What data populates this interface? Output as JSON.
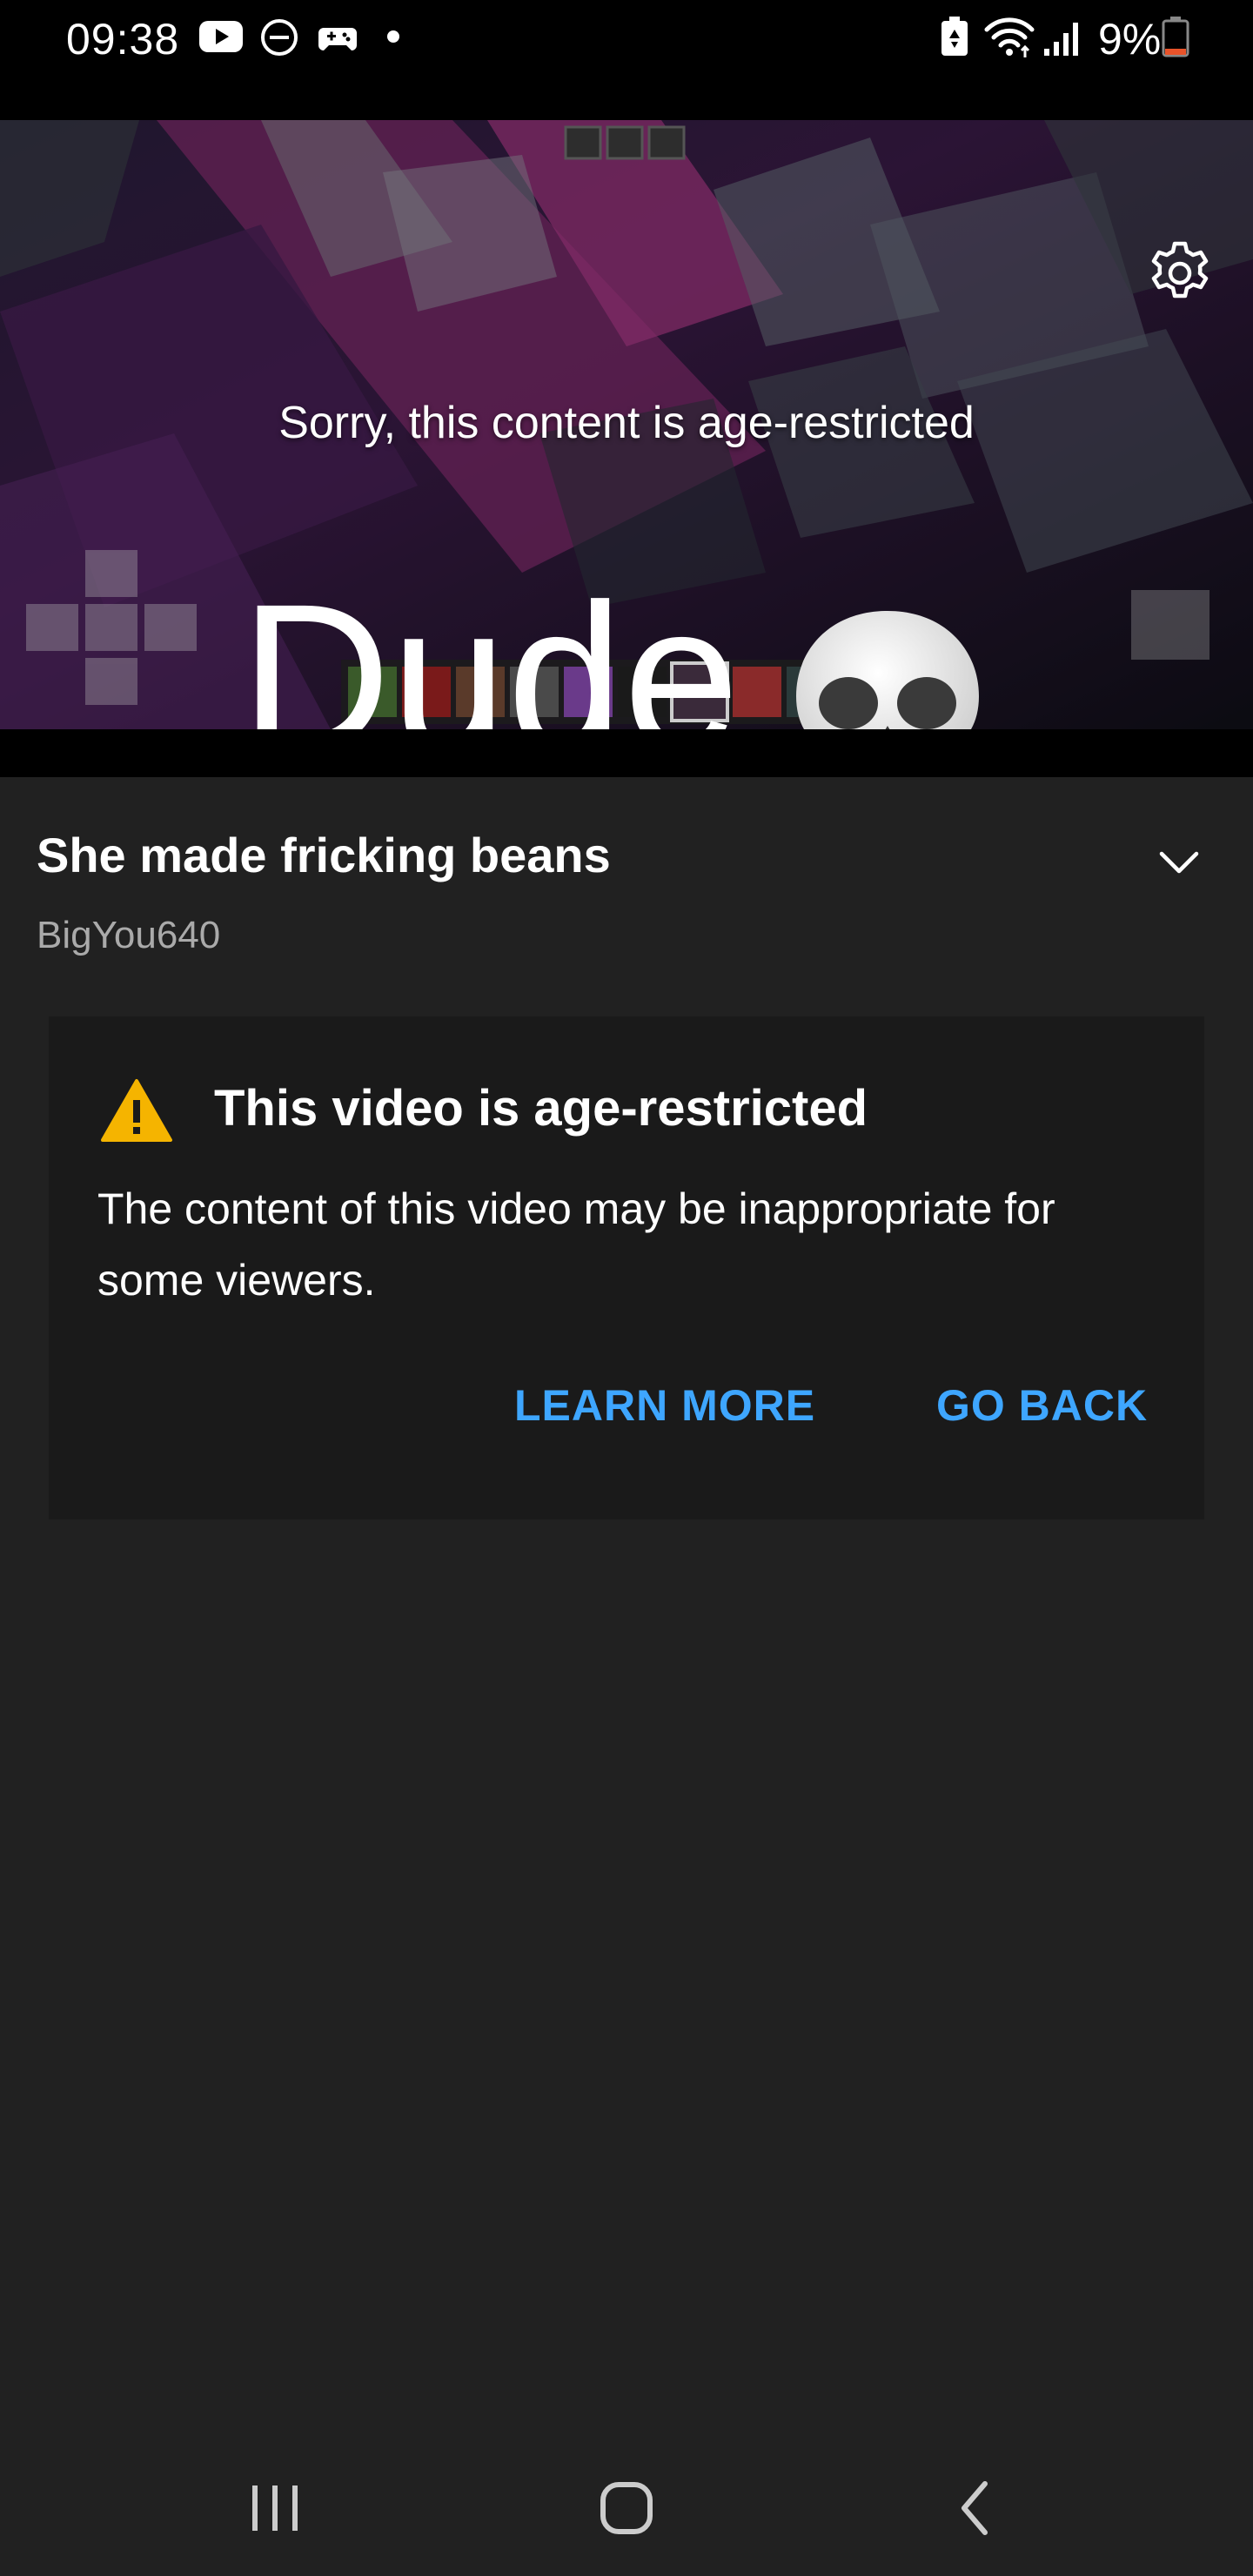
{
  "status_bar": {
    "time": "09:38",
    "battery_percent": "9%",
    "icons": [
      "youtube-icon",
      "do-not-disturb-icon",
      "gamepad-icon",
      "notification-dot-icon",
      "battery-saver-icon",
      "wifi-icon",
      "signal-icon",
      "battery-icon"
    ]
  },
  "player": {
    "restricted_message": "Sorry, this content is age-restricted",
    "overlay_caption": "Dude"
  },
  "video": {
    "title": "She made fricking beans",
    "channel": "BigYou640"
  },
  "warning": {
    "title": "This video is age-restricted",
    "body": "The content of this video may be inappropriate for some viewers.",
    "learn_more": "LEARN MORE",
    "go_back": "GO BACK"
  },
  "colors": {
    "background": "#212121",
    "card": "#1a1a1a",
    "accent_link": "#3ea6ff",
    "warning_yellow": "#f5b400",
    "battery_low": "#e8532a"
  }
}
